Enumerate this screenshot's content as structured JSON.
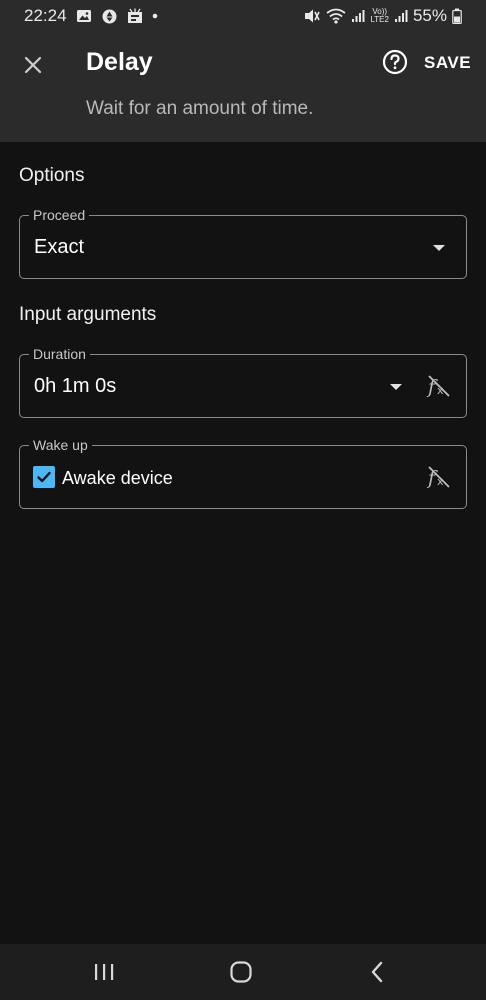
{
  "status_bar": {
    "time": "22:24",
    "battery": "55%",
    "lte_label_top": "Vo))",
    "lte_label_bottom": "LTE2",
    "icons": [
      "gallery-icon",
      "sync-icon",
      "news-icon",
      "dot-icon",
      "mute-icon",
      "wifi-icon",
      "signal-icon",
      "battery-icon"
    ]
  },
  "header": {
    "title": "Delay",
    "subtitle": "Wait for an amount of time.",
    "save_label": "SAVE"
  },
  "options": {
    "section_title": "Options",
    "proceed_label": "Proceed",
    "proceed_value": "Exact"
  },
  "input_arguments": {
    "section_title": "Input arguments",
    "duration_label": "Duration",
    "duration_value": "0h 1m 0s",
    "wakeup_label": "Wake up",
    "wakeup_checkbox_label": "Awake device",
    "wakeup_checked": true
  },
  "colors": {
    "accent": "#4db6f5",
    "background": "#121212",
    "header_bg": "#2b2b2b"
  }
}
